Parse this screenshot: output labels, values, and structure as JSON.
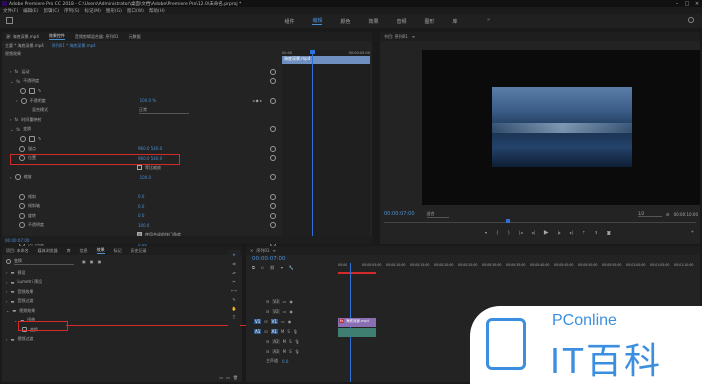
{
  "titlebar": {
    "title": "Adobe Premiere Pro CC 2018 - C:\\Users\\Administrator\\桌面\\文档\\Adobe\\Premiere Pro\\12.0\\未命名.prproj *"
  },
  "menubar": {
    "items": [
      "文件(F)",
      "编辑(E)",
      "剪辑(C)",
      "序列(S)",
      "标记(M)",
      "图形(G)",
      "窗口(W)",
      "帮助(H)"
    ]
  },
  "workspaces": {
    "items": [
      "组件",
      "编辑",
      "颜色",
      "效果",
      "音频",
      "图形",
      "库"
    ],
    "active_index": 1
  },
  "effect_controls": {
    "tabs": [
      "源: 海底深景.mp4",
      "效果控件",
      "音频剪辑混合器: 序列01",
      "元数据"
    ],
    "active_tab": 1,
    "clip_path": "主要 * 海底深景.mp4",
    "sequence_clip": "序列01 * 海底深景.mp4",
    "mini_timecodes": [
      "00:00",
      "00:00:05:00"
    ],
    "mini_clip": "海底深景.mp4",
    "section_video": "视频效果",
    "rows": [
      {
        "name": "运动",
        "indent": 1
      },
      {
        "name": "不透明度",
        "indent": 1
      },
      {
        "name": "不透明度",
        "indent": 2,
        "value": "100.0 %"
      },
      {
        "name": "混合模式",
        "indent": 2,
        "value": "正常"
      },
      {
        "name": "时间重映射",
        "indent": 1
      },
      {
        "name": "变换",
        "indent": 1
      },
      {
        "name": "锚点",
        "indent": 2,
        "value": "960.0   540.0"
      },
      {
        "name": "位置",
        "indent": 2,
        "value": "960.0   540.0"
      },
      {
        "name": "",
        "indent": 2,
        "value": "等比缩放"
      },
      {
        "name": "缩放",
        "indent": 2,
        "value": "100.0"
      },
      {
        "name": "",
        "indent": 2,
        "value": ""
      },
      {
        "name": "倾斜",
        "indent": 2,
        "value": "0.0"
      },
      {
        "name": "倾斜轴",
        "indent": 2,
        "value": "0.0"
      },
      {
        "name": "旋转",
        "indent": 2,
        "value": "0.0"
      },
      {
        "name": "不透明度",
        "indent": 2,
        "value": "100.0"
      },
      {
        "name": "",
        "indent": 2,
        "value": "使用合成的快门角度"
      },
      {
        "name": "快门角度",
        "indent": 2,
        "value": "0.00"
      }
    ],
    "footer_timecode": "00:00:07:00"
  },
  "program_monitor": {
    "title": "节目: 序列01",
    "timecode": "00:00:07:00",
    "fit": "适合",
    "ratio": "1/2",
    "duration": "00:00:10:00"
  },
  "effects_panel": {
    "tabs": [
      "项目: 未命名",
      "媒体浏览器",
      "库",
      "信息",
      "效果",
      "标记",
      "历史记录"
    ],
    "active_tab": 4,
    "search_value": "变换",
    "tree": [
      {
        "label": "预设",
        "indent": 0
      },
      {
        "label": "Lumetri 预设",
        "indent": 0
      },
      {
        "label": "音频效果",
        "indent": 0
      },
      {
        "label": "音频过渡",
        "indent": 0
      },
      {
        "label": "视频效果",
        "indent": 0
      },
      {
        "label": "扭曲",
        "indent": 1
      },
      {
        "label": "变换",
        "indent": 2
      },
      {
        "label": "视频过渡",
        "indent": 0
      }
    ]
  },
  "timeline": {
    "title": "序列01",
    "timecode": "00:00:07:00",
    "ruler": [
      "00:00",
      "00:00:05:00",
      "00:00:10:00",
      "00:00:15:00",
      "00:00:20:00",
      "00:00:25:00",
      "00:00:30:00",
      "00:00:35:00",
      "00:00:40:00",
      "00:00:45:00",
      "00:00:50:00",
      "00:00:55:00",
      "00:01:00:00",
      "00:01:05:00",
      "00:01:10:00"
    ],
    "video_tracks": [
      "V3",
      "V2",
      "V1"
    ],
    "audio_tracks": [
      "A1",
      "A2",
      "A3"
    ],
    "master": "主声道",
    "master_value": "0.0",
    "clip_label": "海底深景.mp4"
  },
  "watermark": {
    "line1": "PConline",
    "line2": "IT百科"
  },
  "colors": {
    "accent": "#4a8fd6",
    "highlight_red": "#d32a2a",
    "playhead": "#2f6fd8"
  }
}
